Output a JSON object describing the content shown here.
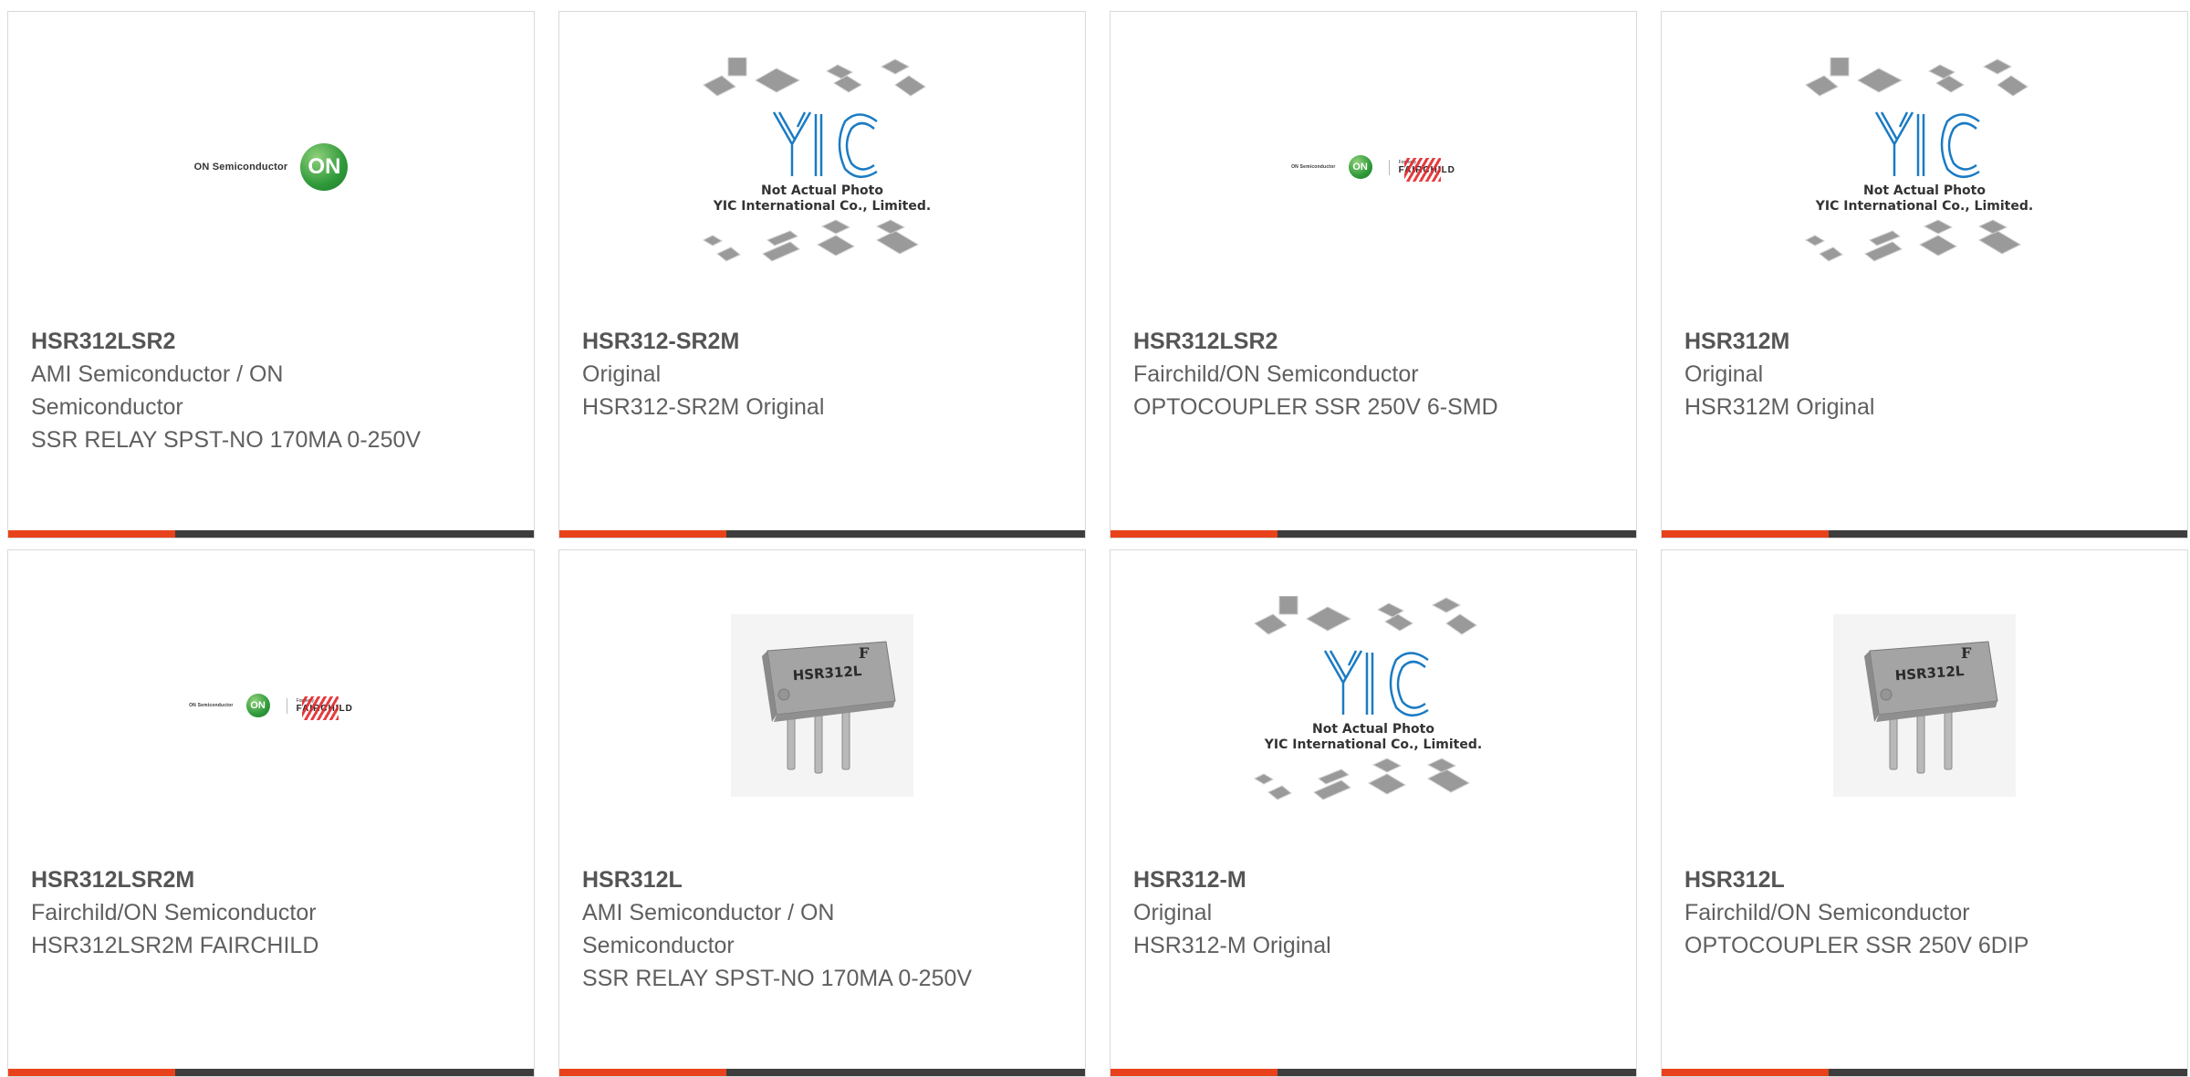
{
  "products": [
    {
      "part": "HSR312LSR2",
      "mfr": "AMI Semiconductor / ON Semiconductor",
      "desc": "SSR RELAY SPST-NO 170MA 0-250V",
      "image": "on-semiconductor-logo"
    },
    {
      "part": "HSR312-SR2M",
      "mfr": "Original",
      "desc": "HSR312-SR2M Original",
      "image": "yic-placeholder"
    },
    {
      "part": "HSR312LSR2",
      "mfr": "Fairchild/ON Semiconductor",
      "desc": "OPTOCOUPLER SSR 250V 6-SMD",
      "image": "on-fairchild-logo"
    },
    {
      "part": "HSR312M",
      "mfr": "Original",
      "desc": "HSR312M Original",
      "image": "yic-placeholder"
    },
    {
      "part": "HSR312LSR2M",
      "mfr": "Fairchild/ON Semiconductor",
      "desc": "HSR312LSR2M FAIRCHILD",
      "image": "on-fairchild-logo"
    },
    {
      "part": "HSR312L",
      "mfr": "AMI Semiconductor / ON Semiconductor",
      "desc": "SSR RELAY SPST-NO 170MA 0-250V",
      "image": "dip6-chip-photo"
    },
    {
      "part": "HSR312-M",
      "mfr": "Original",
      "desc": "HSR312-M Original",
      "image": "yic-placeholder"
    },
    {
      "part": "HSR312L",
      "mfr": "Fairchild/ON Semiconductor",
      "desc": "OPTOCOUPLER SSR 250V 6DIP",
      "image": "dip6-chip-photo"
    }
  ],
  "logos": {
    "on_text": "ON Semiconductor",
    "on_mark": "ON",
    "formerly": "Formerly",
    "fairchild": "FAIRCHILD"
  },
  "placeholder": {
    "line1": "Not Actual Photo",
    "line2": "YIC International Co., Limited."
  },
  "chip_marking": "HSR312L",
  "colors": {
    "accent": "#e8421c",
    "bar": "#3d3d3d",
    "border": "#d9d9d9",
    "yic": "#1a7bc4"
  }
}
